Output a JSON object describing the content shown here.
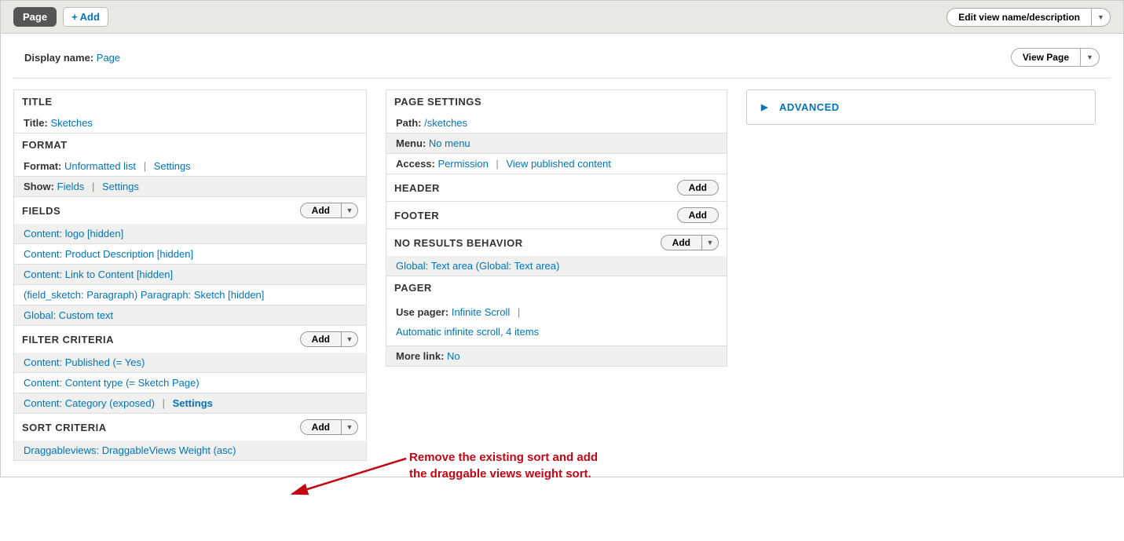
{
  "topbar": {
    "tab": "Page",
    "add": "Add",
    "edit_view": "Edit view name/description"
  },
  "display": {
    "label": "Display name:",
    "value": "Page",
    "view_button": "View Page"
  },
  "left": {
    "title_heading": "TITLE",
    "title_label": "Title:",
    "title_value": "Sketches",
    "format_heading": "FORMAT",
    "format_label": "Format:",
    "format_value": "Unformatted list",
    "settings": "Settings",
    "show_label": "Show:",
    "show_value": "Fields",
    "fields_heading": "FIELDS",
    "add": "Add",
    "fields_items": [
      "Content: logo [hidden]",
      "Content: Product Description [hidden]",
      "Content: Link to Content [hidden]",
      "(field_sketch: Paragraph) Paragraph: Sketch [hidden]",
      "Global: Custom text"
    ],
    "filter_heading": "FILTER CRITERIA",
    "filter_items": [
      {
        "text": "Content: Published (= Yes)",
        "settings": false
      },
      {
        "text": "Content: Content type (= Sketch Page)",
        "settings": false
      },
      {
        "text": "Content: Category (exposed)",
        "settings": true
      }
    ],
    "sort_heading": "SORT CRITERIA",
    "sort_items": [
      "Draggableviews: DraggableViews Weight (asc)"
    ]
  },
  "mid": {
    "page_settings_heading": "PAGE SETTINGS",
    "path_label": "Path:",
    "path_value": "/sketches",
    "menu_label": "Menu:",
    "menu_value": "No menu",
    "access_label": "Access:",
    "access_value": "Permission",
    "access_detail": "View published content",
    "header_heading": "HEADER",
    "footer_heading": "FOOTER",
    "noresults_heading": "NO RESULTS BEHAVIOR",
    "noresults_item": "Global: Text area (Global: Text area)",
    "pager_heading": "PAGER",
    "pager_label": "Use pager:",
    "pager_value": "Infinite Scroll",
    "pager_detail": "Automatic infinite scroll, 4 items",
    "more_label": "More link:",
    "more_value": "No",
    "add": "Add"
  },
  "advanced": "ADVANCED",
  "annotation": "Remove the existing sort and add\nthe draggable views weight sort."
}
